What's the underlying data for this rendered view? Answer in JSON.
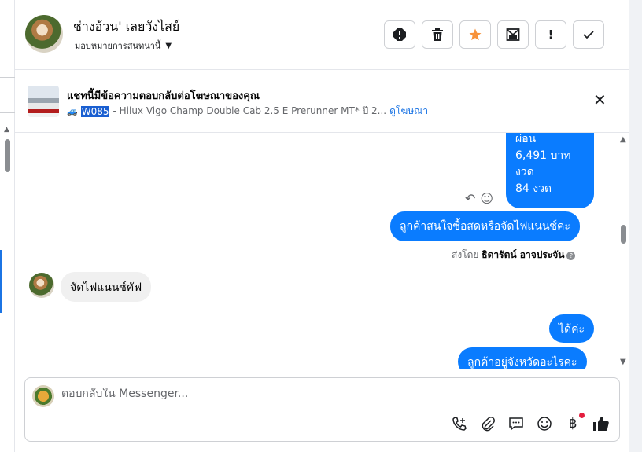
{
  "header": {
    "contact_name": "ช่างอ้วน' เลยวังไสย์",
    "assign_label": "มอบหมายการสนทนานี้",
    "buttons": [
      {
        "name": "report",
        "glyph": "!"
      },
      {
        "name": "delete",
        "glyph": "🗑"
      },
      {
        "name": "star",
        "glyph": "★"
      },
      {
        "name": "mark-unread",
        "glyph": "✉"
      },
      {
        "name": "important",
        "glyph": "!"
      },
      {
        "name": "done",
        "glyph": "✓"
      }
    ],
    "colors": {
      "star": "#f7923b"
    }
  },
  "ad": {
    "title": "แชทนี้มีข้อความตอบกลับต่อโฆษณาของคุณ",
    "code": "W085",
    "description": " - Hilux Vigo Champ Double Cab 2.5 E Prerunner MT* ปี 2...",
    "link": "ดูโฆษณา"
  },
  "messages": {
    "installment_lines": [
      "ผ่อน",
      "6,491 บาท",
      "งวด",
      "84 งวด"
    ],
    "out1": "ลูกค้าสนใจซื้อสดหรือจัดไฟแนนซ์คะ",
    "sent_by_prefix": "ส่งโดย ",
    "sent_by_name": "ธิดารัตน์ อาจประจัน",
    "in1": "จัดไฟแนนซ์คัฟ",
    "out2": "ได้ค่ะ",
    "out3": "ลูกค้าอยู่จังหวัดอะไรคะ"
  },
  "composer": {
    "placeholder": "ตอบกลับใน Messenger..."
  },
  "colors": {
    "outgoing_bubble": "#0a7cff",
    "incoming_bubble": "#f0f0f0",
    "accent": "#1b74e4"
  }
}
